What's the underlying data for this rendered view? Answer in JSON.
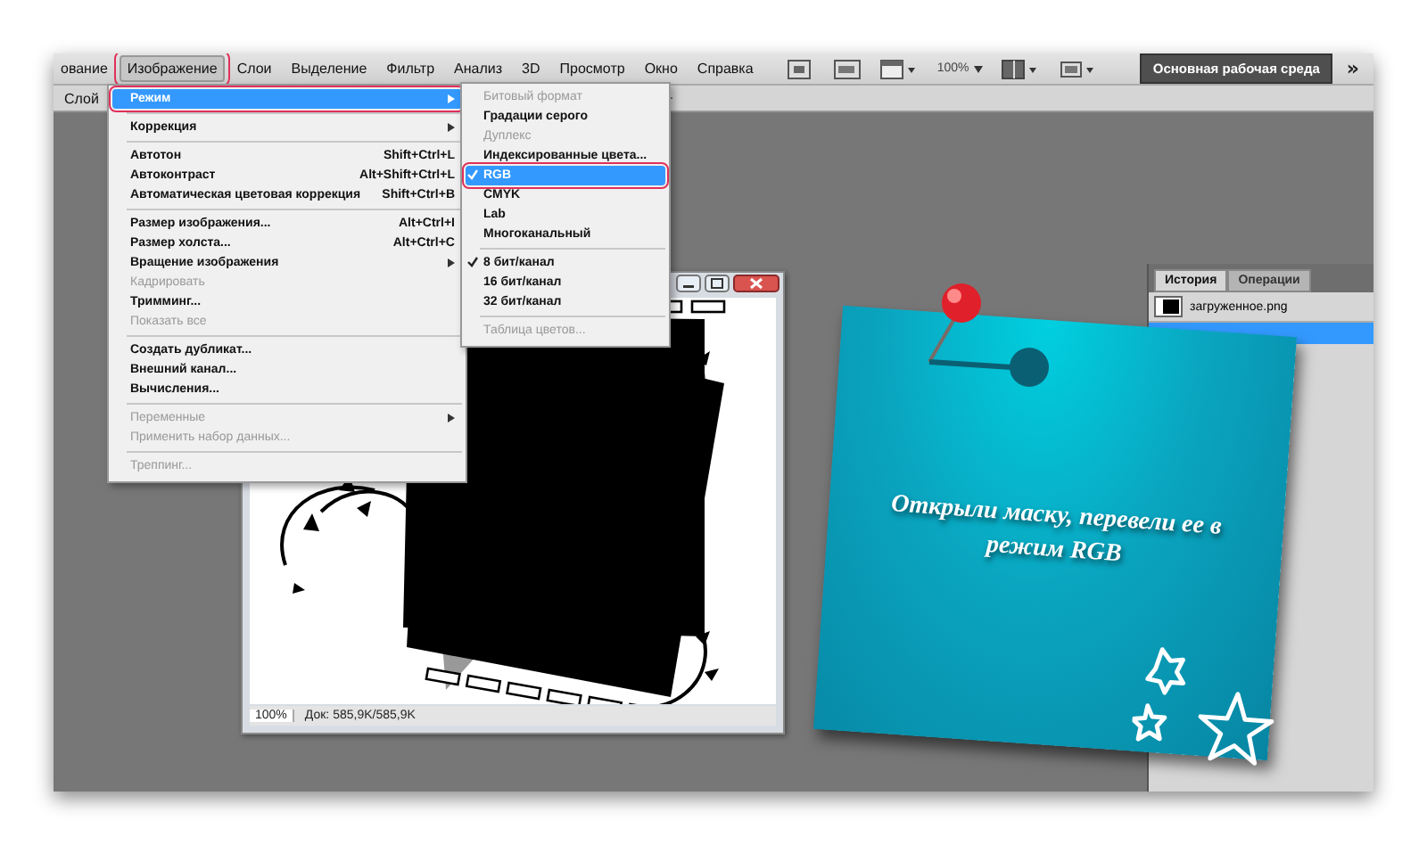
{
  "menubar": {
    "items": [
      {
        "label": "ование",
        "selected": false
      },
      {
        "label": "Изображение",
        "selected": true
      },
      {
        "label": "Слои",
        "selected": false
      },
      {
        "label": "Выделение",
        "selected": false
      },
      {
        "label": "Фильтр",
        "selected": false
      },
      {
        "label": "Анализ",
        "selected": false
      },
      {
        "label": "3D",
        "selected": false
      },
      {
        "label": "Просмотр",
        "selected": false
      },
      {
        "label": "Окно",
        "selected": false
      },
      {
        "label": "Справка",
        "selected": false
      }
    ],
    "zoom": "100%",
    "workspace_button": "Основная рабочая среда",
    "more": "»"
  },
  "options_bar": {
    "label": "Слой"
  },
  "image_menu": {
    "items": [
      {
        "kind": "item",
        "label": "Режим",
        "submenu": true,
        "disabled": false,
        "selected": true
      },
      {
        "kind": "separator"
      },
      {
        "kind": "item",
        "label": "Коррекция",
        "submenu": true,
        "disabled": false,
        "selected": false
      },
      {
        "kind": "separator"
      },
      {
        "kind": "item",
        "label": "Автотон",
        "shortcut": "Shift+Ctrl+L",
        "submenu": false,
        "disabled": false,
        "selected": false
      },
      {
        "kind": "item",
        "label": "Автоконтраст",
        "shortcut": "Alt+Shift+Ctrl+L",
        "submenu": false,
        "disabled": false,
        "selected": false
      },
      {
        "kind": "item",
        "label": "Автоматическая цветовая коррекция",
        "shortcut": "Shift+Ctrl+B",
        "submenu": false,
        "disabled": false,
        "selected": false
      },
      {
        "kind": "separator"
      },
      {
        "kind": "item",
        "label": "Размер изображения...",
        "shortcut": "Alt+Ctrl+I",
        "submenu": false,
        "disabled": false,
        "selected": false
      },
      {
        "kind": "item",
        "label": "Размер холста...",
        "shortcut": "Alt+Ctrl+C",
        "submenu": false,
        "disabled": false,
        "selected": false
      },
      {
        "kind": "item",
        "label": "Вращение изображения",
        "submenu": true,
        "disabled": false,
        "selected": false
      },
      {
        "kind": "item",
        "label": "Кадрировать",
        "submenu": false,
        "disabled": true,
        "selected": false
      },
      {
        "kind": "item",
        "label": "Тримминг...",
        "submenu": false,
        "disabled": false,
        "selected": false
      },
      {
        "kind": "item",
        "label": "Показать все",
        "submenu": false,
        "disabled": true,
        "selected": false
      },
      {
        "kind": "separator"
      },
      {
        "kind": "item",
        "label": "Создать дубликат...",
        "submenu": false,
        "disabled": false,
        "selected": false
      },
      {
        "kind": "item",
        "label": "Внешний канал...",
        "submenu": false,
        "disabled": false,
        "selected": false
      },
      {
        "kind": "item",
        "label": "Вычисления...",
        "submenu": false,
        "disabled": false,
        "selected": false
      },
      {
        "kind": "separator"
      },
      {
        "kind": "item",
        "label": "Переменные",
        "submenu": true,
        "disabled": true,
        "selected": false
      },
      {
        "kind": "item",
        "label": "Применить набор данных...",
        "submenu": false,
        "disabled": true,
        "selected": false
      },
      {
        "kind": "separator"
      },
      {
        "kind": "item",
        "label": "Треппинг...",
        "submenu": false,
        "disabled": true,
        "selected": false
      }
    ]
  },
  "mode_submenu": {
    "items": [
      {
        "kind": "item",
        "label": "Битовый формат",
        "checked": false,
        "disabled": true,
        "selected": false
      },
      {
        "kind": "item",
        "label": "Градации серого",
        "checked": false,
        "disabled": false,
        "selected": false
      },
      {
        "kind": "item",
        "label": "Дуплекс",
        "checked": false,
        "disabled": true,
        "selected": false
      },
      {
        "kind": "item",
        "label": "Индексированные цвета...",
        "checked": false,
        "disabled": false,
        "selected": false
      },
      {
        "kind": "item",
        "label": "RGB",
        "checked": true,
        "disabled": false,
        "selected": true
      },
      {
        "kind": "item",
        "label": "CMYK",
        "checked": false,
        "disabled": false,
        "selected": false
      },
      {
        "kind": "item",
        "label": "Lab",
        "checked": false,
        "disabled": false,
        "selected": false
      },
      {
        "kind": "item",
        "label": "Многоканальный",
        "checked": false,
        "disabled": false,
        "selected": false
      },
      {
        "kind": "separator"
      },
      {
        "kind": "item",
        "label": "8 бит/канал",
        "checked": true,
        "disabled": false,
        "selected": false
      },
      {
        "kind": "item",
        "label": "16 бит/канал",
        "checked": false,
        "disabled": false,
        "selected": false
      },
      {
        "kind": "item",
        "label": "32 бит/канал",
        "checked": false,
        "disabled": false,
        "selected": false
      },
      {
        "kind": "separator"
      },
      {
        "kind": "item",
        "label": "Таблица цветов...",
        "checked": false,
        "disabled": true,
        "selected": false
      }
    ]
  },
  "document": {
    "zoom": "100%",
    "status": "Док: 585,9K/585,9K"
  },
  "note": {
    "text": "Открыли маску, перевели ее в режим RGB"
  },
  "history_panel": {
    "tabs": [
      {
        "label": "История",
        "selected": true
      },
      {
        "label": "Операции",
        "selected": false
      }
    ],
    "items": [
      {
        "label": "загруженное.png",
        "selected": false
      }
    ]
  }
}
